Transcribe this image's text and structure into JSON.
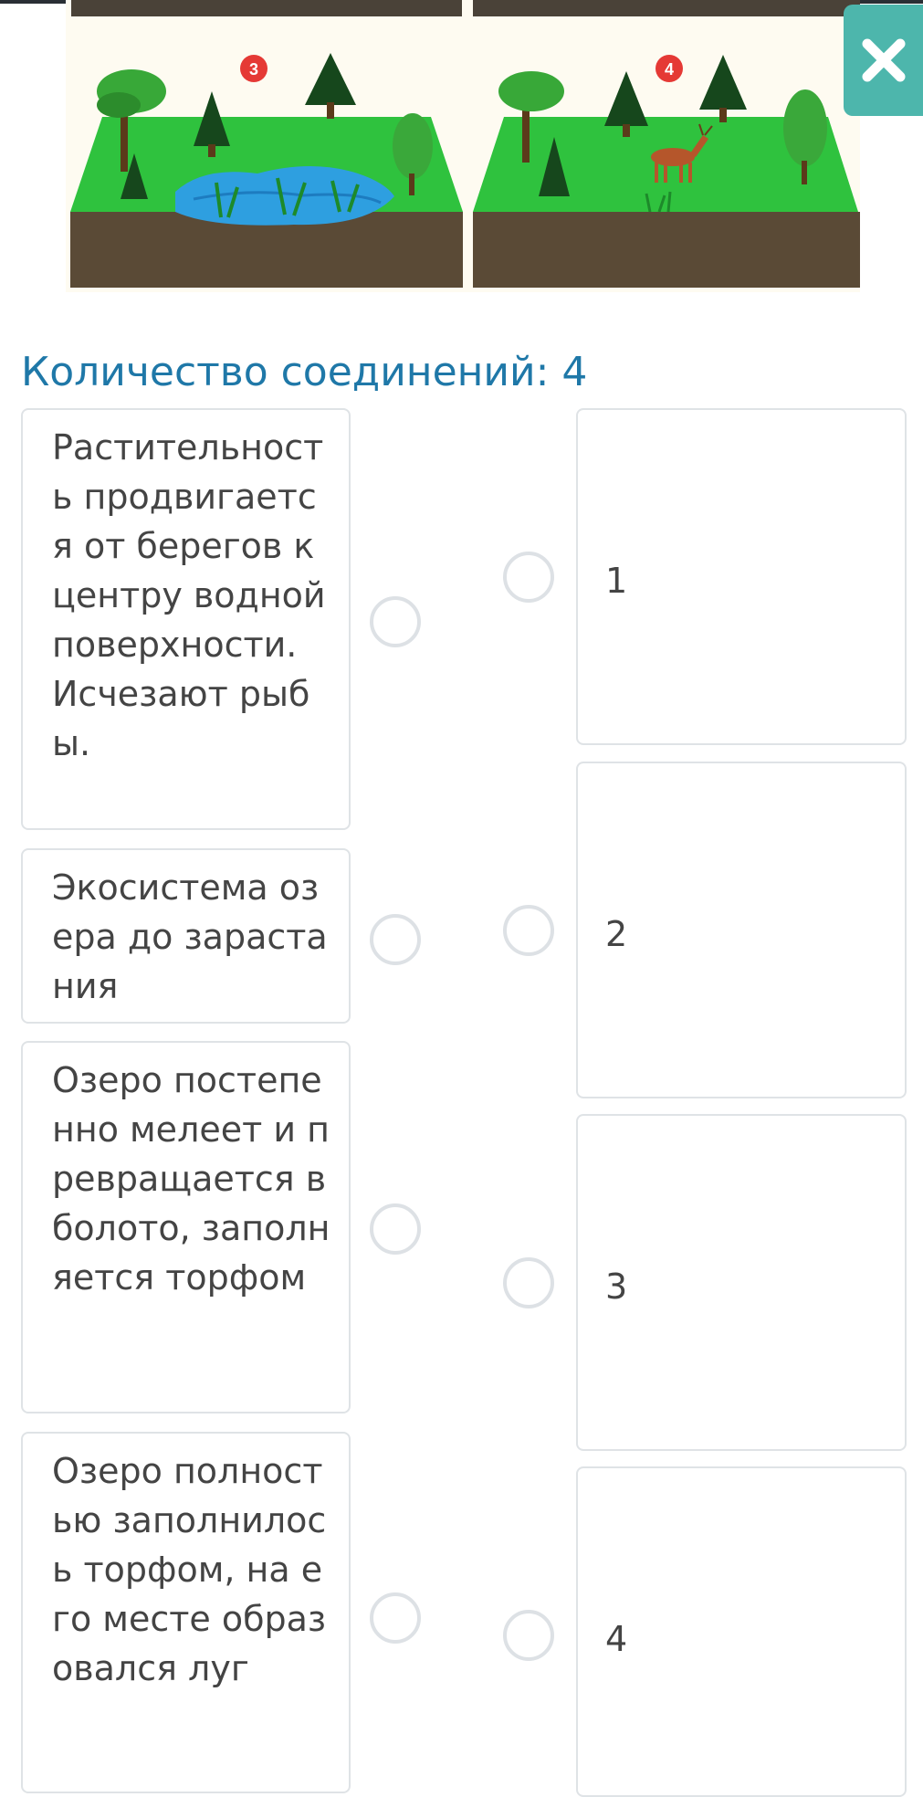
{
  "illustration": {
    "badges": [
      "3",
      "4"
    ]
  },
  "close_icon": "close-icon",
  "connections_title": "Количество соединений: 4",
  "statements": [
    {
      "text": "Растительность продвигается от берегов к центру водной поверхности. Исчезают рыбы."
    },
    {
      "text": "Экосистема озера до зарастания"
    },
    {
      "text": "Озеро постепенно мелеет и превращается в болото, заполняется торфом"
    },
    {
      "text": "Озеро полностью заполнилось торфом, на его месте образовался луг"
    }
  ],
  "answers": [
    "1",
    "2",
    "3",
    "4"
  ],
  "colors": {
    "accent": "#4db6ac",
    "title": "#1f78a8",
    "border": "#dfe3e6",
    "grass": "#2fc23e",
    "water": "#2e9fe0",
    "soil": "#5a4a36",
    "badge": "#e53935"
  }
}
